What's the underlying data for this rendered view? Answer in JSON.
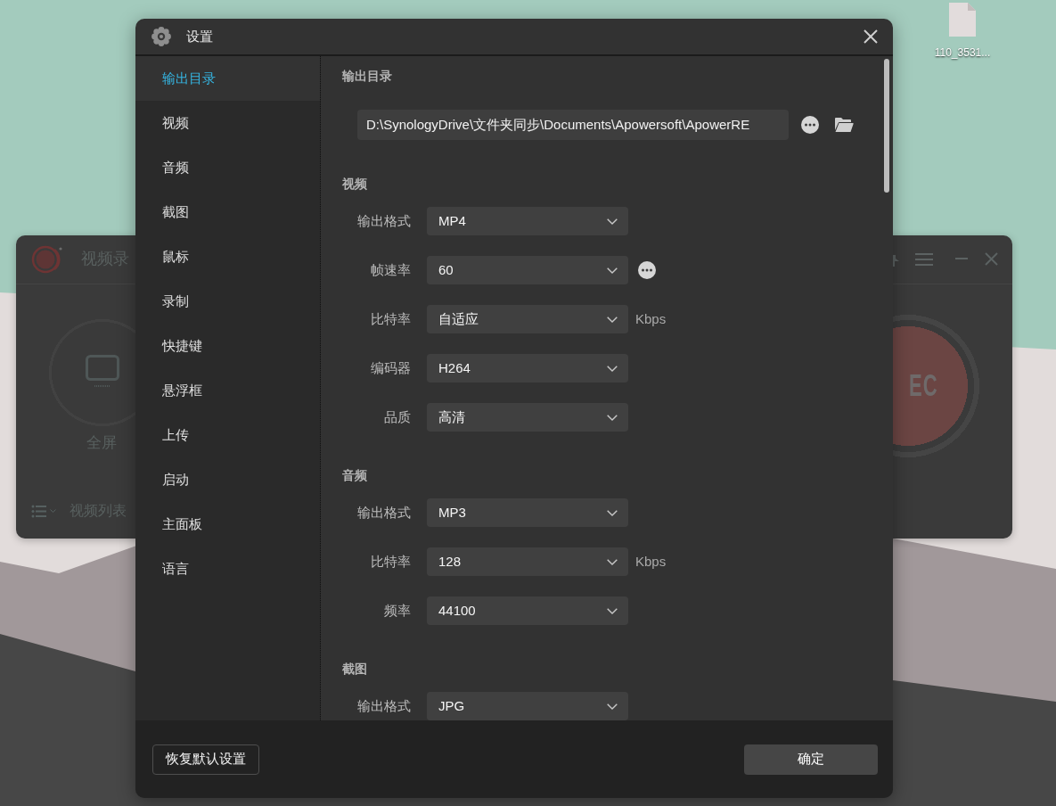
{
  "desktop": {
    "icons": [
      {
        "label": "110_3531..."
      }
    ]
  },
  "recorder_window": {
    "title": "视频录",
    "mode_label": "全屏",
    "list_label": "视频列表",
    "record_label": "EC"
  },
  "settings_dialog": {
    "title": "设置",
    "sidebar": {
      "items": [
        {
          "label": "输出目录",
          "selected": true
        },
        {
          "label": "视频",
          "selected": false
        },
        {
          "label": "音频",
          "selected": false
        },
        {
          "label": "截图",
          "selected": false
        },
        {
          "label": "鼠标",
          "selected": false
        },
        {
          "label": "录制",
          "selected": false
        },
        {
          "label": "快捷键",
          "selected": false
        },
        {
          "label": "悬浮框",
          "selected": false
        },
        {
          "label": "上传",
          "selected": false
        },
        {
          "label": "启动",
          "selected": false
        },
        {
          "label": "主面板",
          "selected": false
        },
        {
          "label": "语言",
          "selected": false
        }
      ]
    },
    "sections": [
      {
        "kind": "path",
        "heading": "输出目录",
        "path": "D:\\SynologyDrive\\文件夹同步\\Documents\\Apowersoft\\ApowerRE"
      },
      {
        "kind": "form",
        "heading": "视频",
        "rows": [
          {
            "label": "输出格式",
            "value": "MP4"
          },
          {
            "label": "帧速率",
            "value": "60",
            "more_button": true
          },
          {
            "label": "比特率",
            "value": "自适应",
            "unit": "Kbps"
          },
          {
            "label": "编码器",
            "value": "H264"
          },
          {
            "label": "品质",
            "value": "高清"
          }
        ]
      },
      {
        "kind": "form",
        "heading": "音频",
        "rows": [
          {
            "label": "输出格式",
            "value": "MP3"
          },
          {
            "label": "比特率",
            "value": "128",
            "unit": "Kbps"
          },
          {
            "label": "频率",
            "value": "44100"
          }
        ]
      },
      {
        "kind": "form",
        "heading": "截图",
        "rows": [
          {
            "label": "输出格式",
            "value": "JPG"
          }
        ]
      }
    ],
    "buttons": [
      {
        "kind": "secondary",
        "label": "恢复默认设置"
      },
      {
        "kind": "primary",
        "label": "确定"
      }
    ]
  }
}
